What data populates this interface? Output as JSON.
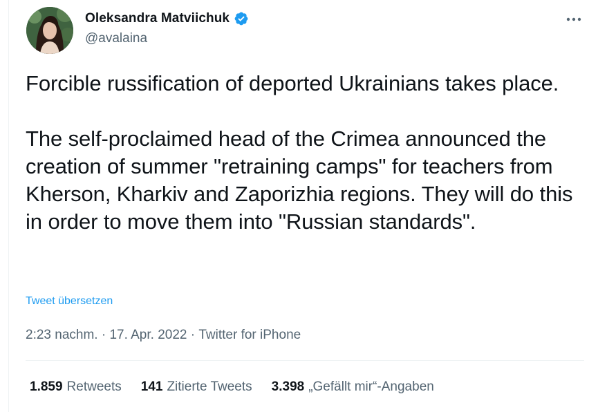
{
  "author": {
    "display_name": "Oleksandra Matviichuk",
    "handle": "@avalaina",
    "verified": true
  },
  "tweet": {
    "text": "Forcible russification of deported Ukrainians takes place.\n\nThe self-proclaimed head of the Crimea announced the creation of summer \"retraining camps\" for teachers from Kherson, Kharkiv and Zaporizhia regions. They will do this in order to move them into \"Russian standards\".",
    "translate_label": "Tweet übersetzen"
  },
  "meta": {
    "time": "2:23 nachm.",
    "separator": " · ",
    "date": "17. Apr. 2022",
    "source": "Twitter for iPhone"
  },
  "stats": {
    "retweets_count": "1.859",
    "retweets_label": "Retweets",
    "quotes_count": "141",
    "quotes_label": "Zitierte Tweets",
    "likes_count": "3.398",
    "likes_label": "„Gefällt mir“-Angaben"
  },
  "colors": {
    "link": "#1d9bf0",
    "secondary_text": "#536471",
    "primary_text": "#0f1419",
    "verified_badge": "#1d9bf0",
    "divider": "#eff3f4"
  },
  "icons": {
    "verified": "verified-badge-icon",
    "more": "more-options-icon"
  }
}
